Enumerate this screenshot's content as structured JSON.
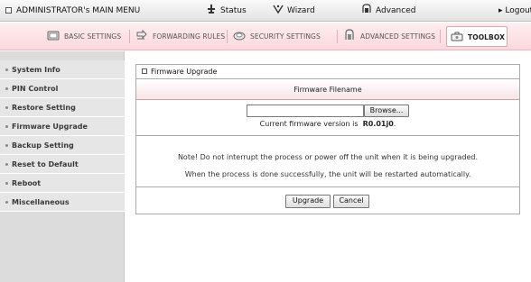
{
  "topbar": {
    "menu_title": "ADMINISTRATOR's MAIN MENU",
    "status": "Status",
    "wizard": "Wizard",
    "advanced": "Advanced",
    "logout": "▸ Logout"
  },
  "tabs": {
    "basic": "BASIC SETTINGS",
    "forwarding": "FORWARDING RULES",
    "security": "SECURITY SETTINGS",
    "advanced": "ADVANCED SETTINGS",
    "toolbox": "TOOLBOX"
  },
  "sidebar": {
    "items": [
      {
        "label": "System Info"
      },
      {
        "label": "PIN Control"
      },
      {
        "label": "Restore Setting"
      },
      {
        "label": "Firmware Upgrade"
      },
      {
        "label": "Backup Setting"
      },
      {
        "label": "Reset to Default"
      },
      {
        "label": "Reboot"
      },
      {
        "label": "Miscellaneous"
      }
    ]
  },
  "panel": {
    "title": "Firmware Upgrade",
    "section_header": "Firmware Filename",
    "file_value": "",
    "browse_label": "Browse...",
    "version_prefix": "Current firmware version is",
    "version_value": "R0.01j0",
    "version_suffix": ".",
    "note1": "Note! Do not interrupt the process or power off the unit when it is being upgraded.",
    "note2": "When the process is done successfully, the unit will be restarted automatically.",
    "upgrade_label": "Upgrade",
    "cancel_label": "Cancel"
  },
  "colors": {
    "tabbar_pink": "#fbd8dc",
    "sidebar_gray": "#dcdcdc"
  },
  "icons": {
    "status": "status-icon",
    "wizard": "wizard-icon",
    "advanced": "advanced-icon",
    "basic": "basic-settings-icon",
    "forwarding": "forwarding-icon",
    "security": "security-icon",
    "advanced_settings": "advanced-settings-icon",
    "toolbox": "toolbox-icon"
  }
}
